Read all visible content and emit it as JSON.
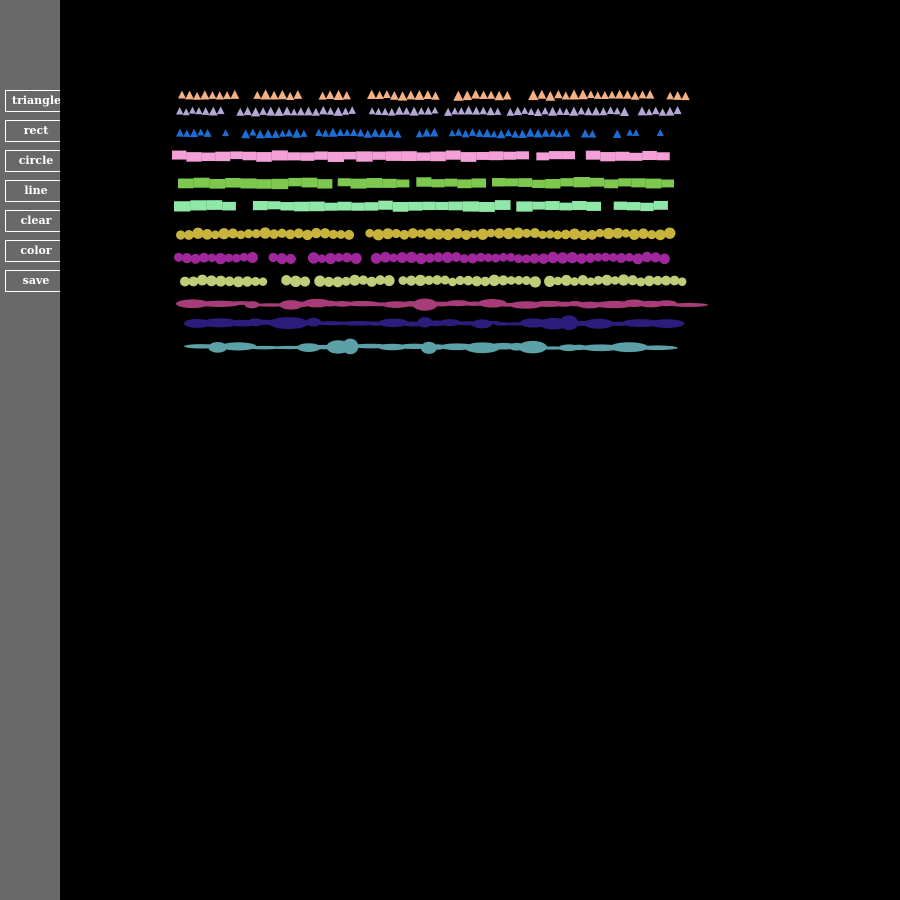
{
  "toolbar": {
    "triangle_label": "triangle",
    "rect_label": "rect",
    "circle_label": "circle",
    "line_label": "line",
    "clear_label": "clear",
    "color_label": "color",
    "save_label": "save"
  },
  "colors": {
    "sidebar_bg": "#696969",
    "canvas_bg": "#000000",
    "button_border": "#ffffff"
  },
  "strokes": [
    {
      "tool": "triangle",
      "color": "#f4b183"
    },
    {
      "tool": "triangle",
      "color": "#b4a7d6"
    },
    {
      "tool": "triangle",
      "color": "#1c6ed6"
    },
    {
      "tool": "rect",
      "color": "#f4a0d8"
    },
    {
      "tool": "rect",
      "color": "#7ec850"
    },
    {
      "tool": "rect",
      "color": "#90e8a8"
    },
    {
      "tool": "circle",
      "color": "#c8b43c"
    },
    {
      "tool": "circle",
      "color": "#a0289c"
    },
    {
      "tool": "circle",
      "color": "#c0cc78"
    },
    {
      "tool": "line",
      "color": "#a83c78"
    },
    {
      "tool": "line",
      "color": "#2c1c7c"
    },
    {
      "tool": "line",
      "color": "#5ca0a8"
    }
  ]
}
